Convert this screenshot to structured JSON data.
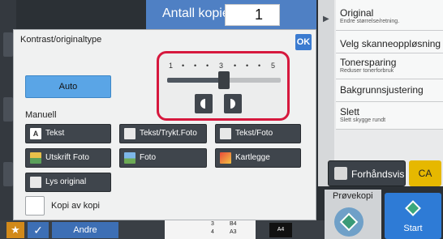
{
  "header": {
    "copies_label": "Antall kopier",
    "copies_value": "1"
  },
  "dialog": {
    "title": "Kontrast/originaltype",
    "ok_label": "OK",
    "auto_label": "Auto",
    "manuell_label": "Manuell",
    "scale": {
      "left": "1",
      "mid": "3",
      "right": "5",
      "dot": "•"
    },
    "contrast_level": 3,
    "contrast_max": 5,
    "modes": [
      {
        "label": "Tekst",
        "icon": "text-icon"
      },
      {
        "label": "Tekst/Trykt.Foto",
        "icon": "document-icon"
      },
      {
        "label": "Tekst/Foto",
        "icon": "document-icon"
      },
      {
        "label": "Utskrift Foto",
        "icon": "printed-photo-icon"
      },
      {
        "label": "Foto",
        "icon": "photo-icon"
      },
      {
        "label": "Kartlegge",
        "icon": "map-icon"
      },
      {
        "label": "Lys original",
        "icon": "document-icon"
      }
    ],
    "text_icon_glyph": "A",
    "kopi_label": "Kopi av kopi"
  },
  "right_panel": {
    "items": [
      {
        "title": "Original",
        "sub": "Endre størrelse/retning."
      },
      {
        "title": "Velg skanneoppløsning",
        "sub": ""
      },
      {
        "title": "Tonersparing",
        "sub": "Reduser tonerforbruk"
      },
      {
        "title": "Bakgrunnsjustering",
        "sub": ""
      },
      {
        "title": "Slett",
        "sub": "Slett skygge rundt"
      }
    ]
  },
  "actions": {
    "preview_label": "Forhåndsvis",
    "ca_label": "CA",
    "provekopi_label": "Prøvekopi",
    "start_label": "Start"
  },
  "bottom": {
    "star_glyph": "★",
    "check_glyph": "✓",
    "andre_label": "Andre",
    "tray3": "3",
    "tray3_size": "B4",
    "tray4": "4",
    "tray4_size": "A3",
    "output_size": "A4"
  },
  "colors": {
    "highlight": "#d6183d",
    "accent": "#3b7bd0",
    "auto_selected": "#5aa5e6"
  }
}
